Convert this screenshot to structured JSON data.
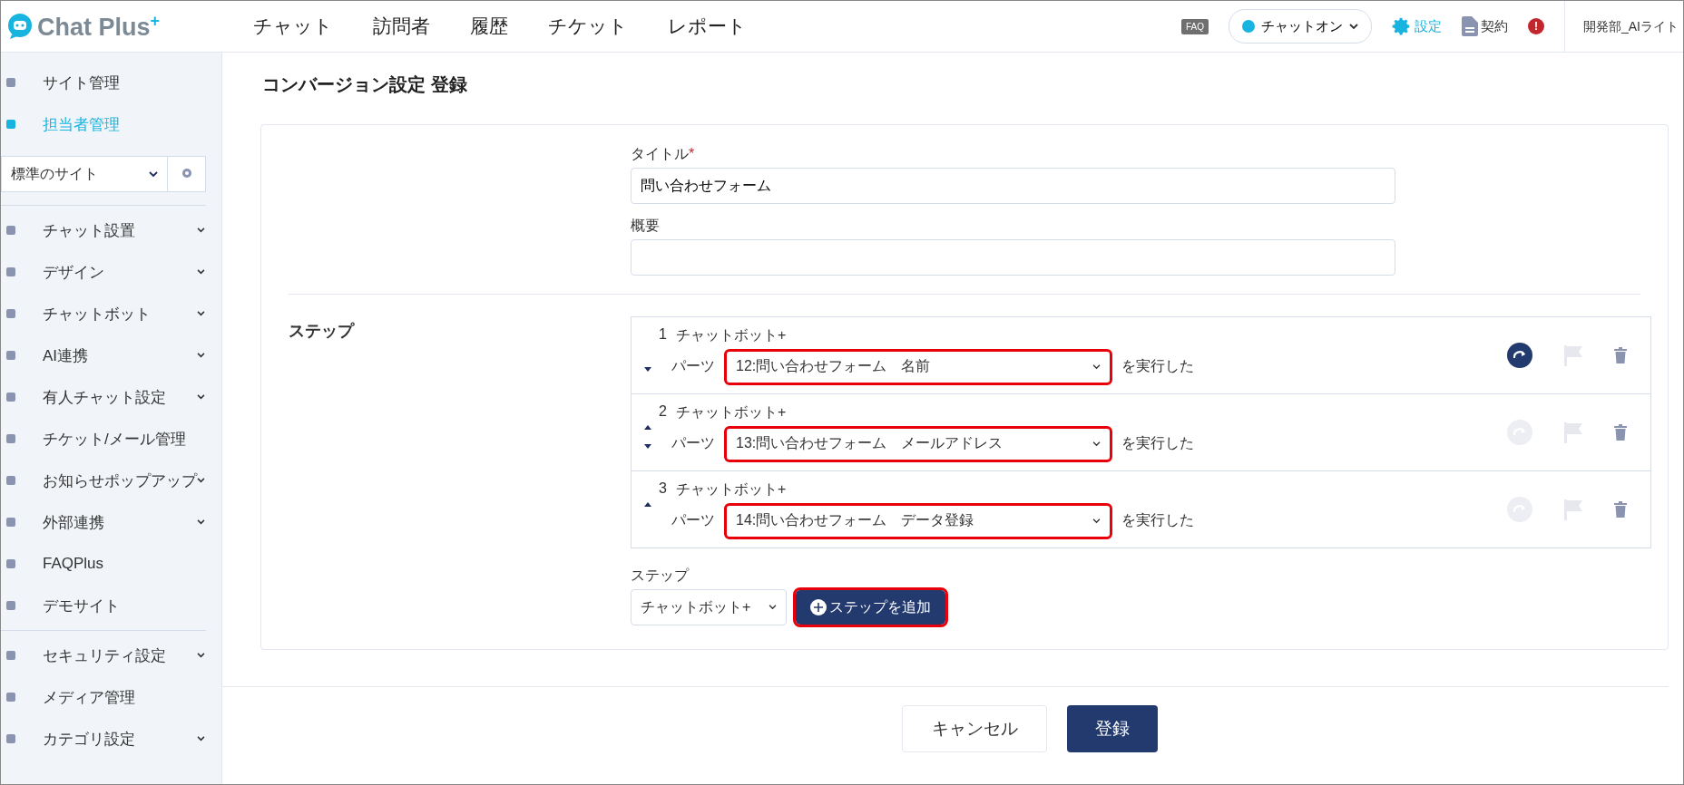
{
  "header": {
    "logo": {
      "text": "Chat Plus",
      "mark": "+"
    },
    "nav": [
      {
        "label": "チャット"
      },
      {
        "label": "訪問者"
      },
      {
        "label": "履歴"
      },
      {
        "label": "チケット"
      },
      {
        "label": "レポート"
      }
    ],
    "faq_badge": "FAQ",
    "status": {
      "label": "チャットオン",
      "on": true
    },
    "settings": "設定",
    "contract": "契約",
    "alert": "!",
    "user": "開発部_AIライト"
  },
  "sidebar": {
    "top_items": [
      {
        "label": "サイト管理",
        "selected": false
      },
      {
        "label": "担当者管理",
        "selected": true
      }
    ],
    "site_select": "標準のサイト",
    "groups": [
      [
        {
          "label": "チャット設置",
          "expandable": true
        },
        {
          "label": "デザイン",
          "expandable": true
        },
        {
          "label": "チャットボット",
          "expandable": true
        },
        {
          "label": "AI連携",
          "expandable": true
        },
        {
          "label": "有人チャット設定",
          "expandable": true
        },
        {
          "label": "チケット/メール管理",
          "expandable": false
        },
        {
          "label": "お知らせポップアップ",
          "expandable": true
        },
        {
          "label": "外部連携",
          "expandable": true
        },
        {
          "label": "FAQPlus",
          "expandable": false
        },
        {
          "label": "デモサイト",
          "expandable": false
        }
      ],
      [
        {
          "label": "セキュリティ設定",
          "expandable": true
        },
        {
          "label": "メディア管理",
          "expandable": false
        },
        {
          "label": "カテゴリ設定",
          "expandable": true
        }
      ]
    ]
  },
  "page_title": "コンバージョン設定 登録",
  "form": {
    "title_label": "タイトル",
    "required_mark": "*",
    "title_value": "問い合わせフォーム",
    "summary_label": "概要",
    "steps_heading": "ステップ",
    "steps": [
      {
        "number": "1",
        "type": "チャットボット+",
        "parts_label": "パーツ",
        "part": "12:問い合わせフォーム　名前",
        "suffix": "を実行した",
        "can_move_up": false,
        "can_move_down": true,
        "jump_active": true,
        "highlighted": true
      },
      {
        "number": "2",
        "type": "チャットボット+",
        "parts_label": "パーツ",
        "part": "13:問い合わせフォーム　メールアドレス",
        "suffix": "を実行した",
        "can_move_up": true,
        "can_move_down": true,
        "jump_active": false,
        "highlighted": true
      },
      {
        "number": "3",
        "type": "チャットボット+",
        "parts_label": "パーツ",
        "part": "14:問い合わせフォーム　データ登録",
        "suffix": "を実行した",
        "can_move_up": true,
        "can_move_down": false,
        "jump_active": false,
        "highlighted": true
      }
    ],
    "new_step_label": "ステップ",
    "new_step_type": "チャットボット+",
    "add_step": {
      "label": "ステップを追加",
      "highlighted": true
    }
  },
  "footer": {
    "cancel": "キャンセル",
    "submit": "登録"
  }
}
